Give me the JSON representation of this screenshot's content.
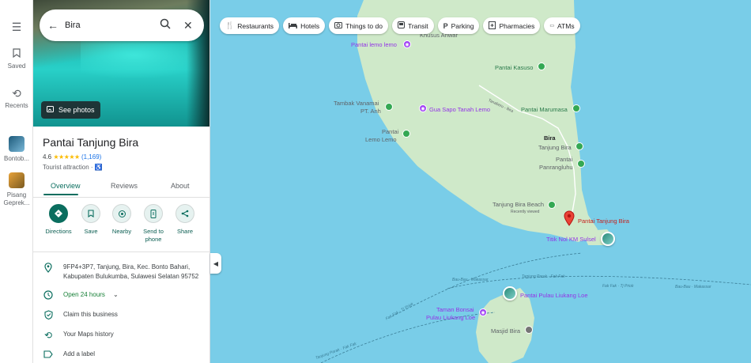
{
  "rail": {
    "menu_icon": "menu-icon",
    "saved_label": "Saved",
    "recents_label": "Recents",
    "recent1_label": "Bontob...",
    "recent2_label": "Pisang Geprek..."
  },
  "search": {
    "value": "Bira"
  },
  "hero": {
    "see_photos_label": "See photos"
  },
  "place": {
    "name": "Pantai Tanjung Bira",
    "rating": "4.6",
    "stars": "★★★★★",
    "reviews_count": "(1,169)",
    "category": "Tourist attraction ·",
    "tabs": [
      "Overview",
      "Reviews",
      "About"
    ],
    "actions": [
      {
        "label": "Directions",
        "icon": "directions-icon"
      },
      {
        "label": "Save",
        "icon": "bookmark-icon"
      },
      {
        "label": "Nearby",
        "icon": "nearby-icon"
      },
      {
        "label": "Send to phone",
        "icon": "phone-icon"
      },
      {
        "label": "Share",
        "icon": "share-icon"
      }
    ],
    "address_line1": "9FP4+3P7, Tanjung, Bira, Kec. Bonto Bahari,",
    "address_line2": "Kabupaten Bulukumba, Sulawesi Selatan 95752",
    "hours": "Open 24 hours",
    "claim": "Claim this business",
    "history": "Your Maps history",
    "add_label": "Add a label"
  },
  "chips": [
    "Restaurants",
    "Hotels",
    "Things to do",
    "Transit",
    "Parking",
    "Pharmacies",
    "ATMs"
  ],
  "map_labels": {
    "khusus_anwar": "Khusus Anwar",
    "pantai_lemo_lemo": "Pantai lemo lemo",
    "pantai_kasuso": "Pantai Kasuso",
    "tambak_vanamai": "Tambak Vanamai",
    "pt_anh": "PT. Anh",
    "gua_sapo": "Gua Sapo Tanah Lemo",
    "road_name": "Tanaberu - Bira",
    "pantai_marumasa": "Pantai Marumasa",
    "pantai_lemo_1": "Pantai",
    "pantai_lemo_2": "Lemo Lemo",
    "bira": "Bira",
    "tanjung_bira": "Tanjung Bira",
    "pantai_panrangluhu_1": "Pantai",
    "pantai_panrangluhu_2": "Panrangluhu",
    "tanjung_bira_beach": "Tanjung Bira Beach",
    "recently_viewed": "Recently viewed",
    "pantai_tanjung_bira": "Pantai Tanjung Bira",
    "titik_nol": "Titik Nol KM Sulsel",
    "ferry1": "Bau-Bau · Makassar",
    "ferry2": "Tanjung Parak · Fak Fak",
    "ferry3": "Fak Fak · Tj Priok",
    "ferry4": "Bau-Bau · Makassar",
    "ferry5": "Fak Fak · Tj Priok",
    "pantai_pulau_liukang": "Pantai Pulau Liukang Loe",
    "taman_bonsai_1": "Taman Bonsai",
    "taman_bonsai_2": "Pulau Liukang Loe",
    "masjid_bira": "Masjid Bira",
    "ferry6": "Tanjung Parak · Fak Fak"
  }
}
